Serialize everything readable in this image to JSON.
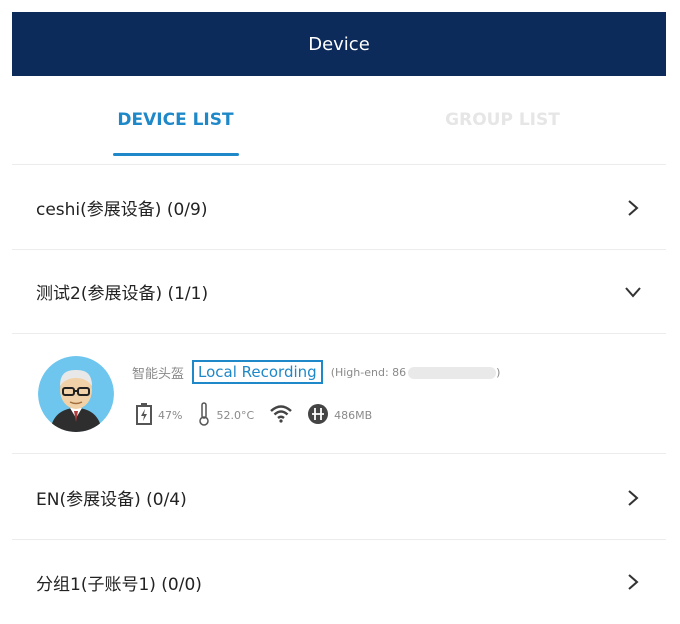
{
  "header": {
    "title": "Device"
  },
  "tabs": [
    {
      "label": "DEVICE LIST"
    },
    {
      "label": "GROUP LIST"
    }
  ],
  "groups": [
    {
      "label": "ceshi(参展设备) (0/9)",
      "expanded": false
    },
    {
      "label": "测试2(参展设备) (1/1)",
      "expanded": true
    },
    {
      "label": "EN(参展设备) (0/4)",
      "expanded": false
    },
    {
      "label": "分组1(子账号1) (0/0)",
      "expanded": false
    }
  ],
  "device": {
    "name": "智能头盔",
    "recording_label": "Local Recording",
    "model_prefix": "(High-end: 86",
    "model_suffix": ")",
    "battery": "47%",
    "temperature": "52.0°C",
    "storage": "486MB"
  },
  "colors": {
    "header_bg": "#0c2a5a",
    "accent": "#1e88c9"
  }
}
